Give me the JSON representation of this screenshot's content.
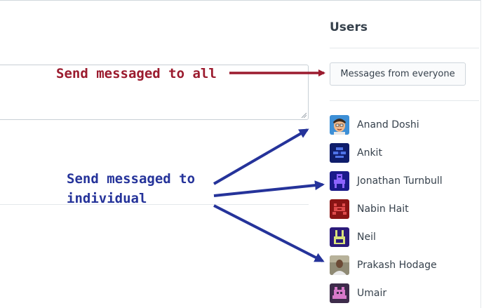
{
  "sidebar": {
    "title": "Users",
    "everyone_button": "Messages from everyone",
    "users": [
      {
        "name": "Anand Doshi",
        "avatar": "cartoon-face-avatar"
      },
      {
        "name": "Ankit",
        "avatar": "blue-pixel-avatar"
      },
      {
        "name": "Jonathan Turnbull",
        "avatar": "purple-pixel-avatar"
      },
      {
        "name": "Nabin Hait",
        "avatar": "red-pixel-avatar"
      },
      {
        "name": "Neil",
        "avatar": "yellow-pixel-avatar"
      },
      {
        "name": "Prakash Hodage",
        "avatar": "photo-avatar"
      },
      {
        "name": "Umair",
        "avatar": "pink-pixel-avatar"
      }
    ]
  },
  "annotations": {
    "all": "Send messaged to all",
    "individual_line1": "Send messaged to",
    "individual_line2": "individual"
  },
  "colors": {
    "annotation_all": "#9b1b2e",
    "annotation_individual": "#25339a"
  }
}
